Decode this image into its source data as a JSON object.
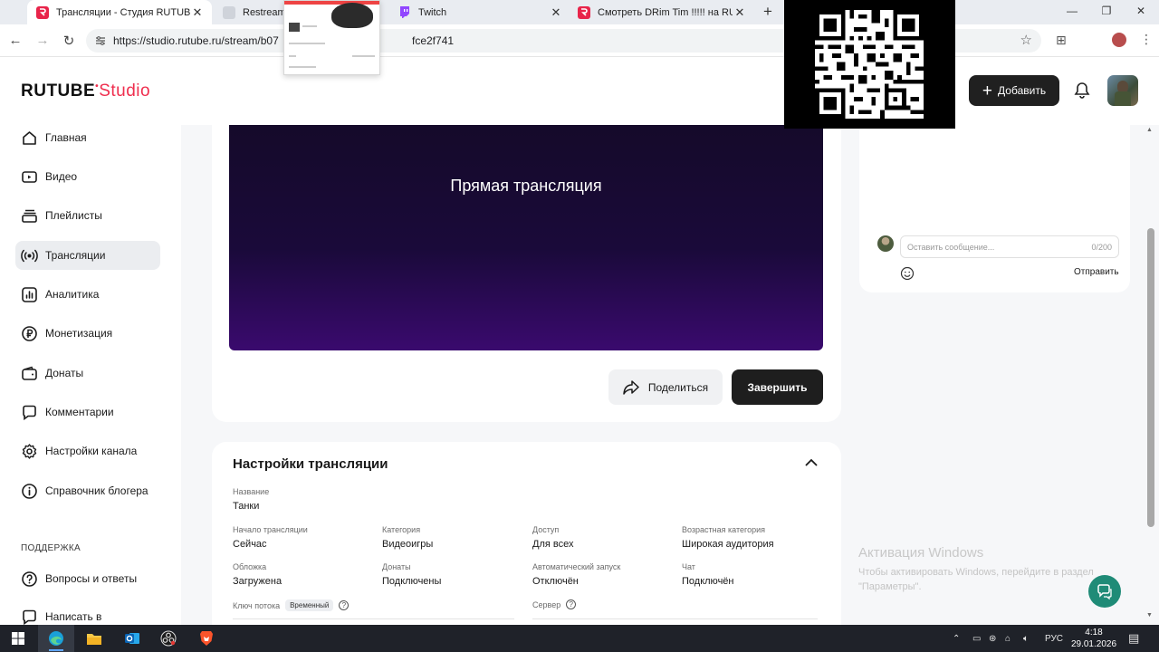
{
  "browser": {
    "tabs": [
      {
        "title": "Трансляции - Студия RUTUBE",
        "active": true
      },
      {
        "title": "Restream",
        "active": false
      },
      {
        "title": "Twitch",
        "active": false
      },
      {
        "title": "Смотреть DRim Tim !!!!! на RUTUBE",
        "active": false
      }
    ],
    "url": "https://studio.rutube.ru/stream/b07",
    "url_tail": "fce2f741"
  },
  "header": {
    "logo_main": "RUTUBE",
    "logo_studio": "Studio",
    "add_button": "Добавить"
  },
  "sidebar": {
    "items": [
      {
        "label": "Главная",
        "icon": "home-icon"
      },
      {
        "label": "Видео",
        "icon": "video-icon"
      },
      {
        "label": "Плейлисты",
        "icon": "playlist-icon"
      },
      {
        "label": "Трансляции",
        "icon": "broadcast-icon"
      },
      {
        "label": "Аналитика",
        "icon": "analytics-icon"
      },
      {
        "label": "Монетизация",
        "icon": "ruble-icon"
      },
      {
        "label": "Донаты",
        "icon": "wallet-icon"
      },
      {
        "label": "Комментарии",
        "icon": "comment-icon"
      },
      {
        "label": "Настройки канала",
        "icon": "gear-icon"
      },
      {
        "label": "Справочник блогера",
        "icon": "info-icon"
      }
    ],
    "support_label": "ПОДДЕРЖКА",
    "support_items": [
      {
        "label": "Вопросы и ответы",
        "icon": "question-icon"
      },
      {
        "label": "Написать в",
        "icon": "chat-icon"
      }
    ]
  },
  "player": {
    "title": "Прямая трансляция",
    "share_button": "Поделиться",
    "finish_button": "Завершить"
  },
  "settings": {
    "title": "Настройки трансляции",
    "name_label": "Название",
    "name_value": "Танки",
    "fields": [
      {
        "label": "Начало трансляции",
        "value": "Сейчас"
      },
      {
        "label": "Категория",
        "value": "Видеоигры"
      },
      {
        "label": "Доступ",
        "value": "Для всех"
      },
      {
        "label": "Возрастная категория",
        "value": "Широкая аудитория"
      },
      {
        "label": "Обложка",
        "value": "Загружена"
      },
      {
        "label": "Донаты",
        "value": "Подключены"
      },
      {
        "label": "Автоматический запуск",
        "value": "Отключён"
      },
      {
        "label": "Чат",
        "value": "Подключён"
      }
    ],
    "stream_key_label": "Ключ потока",
    "stream_key_badge": "Временный",
    "server_label": "Сервер"
  },
  "chat": {
    "placeholder": "Оставить сообщение...",
    "counter": "0/200",
    "send_button": "Отправить"
  },
  "watermark": {
    "title": "Активация Windows",
    "subtitle": "Чтобы активировать Windows, перейдите в раздел \"Параметры\"."
  },
  "taskbar": {
    "lang": "РУС",
    "time": "4:18",
    "date": "29.01.2026"
  }
}
